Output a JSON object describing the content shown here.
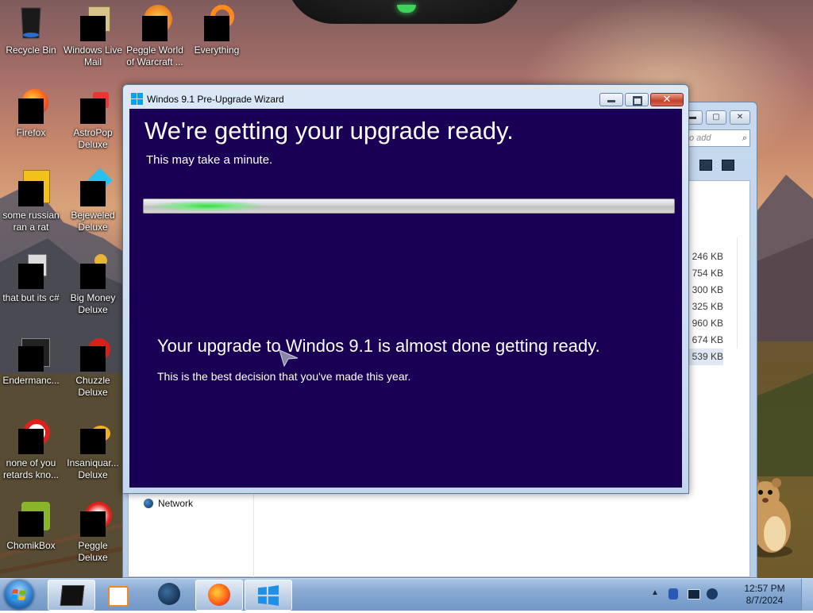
{
  "desktop": {
    "icons": [
      {
        "label": "Recycle Bin",
        "icon": "recycle-bin-icon"
      },
      {
        "label": "Windows Live Mail",
        "icon": "mail-icon"
      },
      {
        "label": "Peggle World of Warcraft ...",
        "icon": "peggle-wow-icon"
      },
      {
        "label": "Everything",
        "icon": "everything-search-icon"
      },
      {
        "label": "Firefox",
        "icon": "firefox-icon"
      },
      {
        "label": "AstroPop Deluxe",
        "icon": "astropop-icon"
      },
      {
        "label": "some russian ran a rat",
        "icon": "file-icon"
      },
      {
        "label": "Bejeweled Deluxe",
        "icon": "bejeweled-icon"
      },
      {
        "label": "that but its c#",
        "icon": "shortcut-icon"
      },
      {
        "label": "Big Money Deluxe",
        "icon": "big-money-icon"
      },
      {
        "label": "Endermanc...",
        "icon": "terminal-icon"
      },
      {
        "label": "Chuzzle Deluxe",
        "icon": "chuzzle-icon"
      },
      {
        "label": "none of you retards kno...",
        "icon": "opera-icon"
      },
      {
        "label": "Insaniquar... Deluxe",
        "icon": "insaniquarium-icon"
      },
      {
        "label": "ChomikBox",
        "icon": "chomikbox-icon"
      },
      {
        "label": "Peggle Deluxe",
        "icon": "peggle-icon"
      }
    ]
  },
  "explorer": {
    "search_placeholder": "o add",
    "network_label": "Network",
    "file_sizes": [
      "246 KB",
      "754 KB",
      "300 KB",
      "325 KB",
      "960 KB",
      "674 KB",
      "539 KB"
    ]
  },
  "wizard": {
    "title": "Windos 9.1 Pre-Upgrade Wizard",
    "headline": "We're getting your upgrade ready.",
    "subheading": "This may take a minute.",
    "progress_indicator": "indeterminate",
    "message": "Your upgrade to Windos 9.1 is almost done getting ready.",
    "message_detail": "This is the best decision that you've made this year.",
    "close_glyph": "✕"
  },
  "taskbar": {
    "items": [
      {
        "name": "taskbar-item-terminal",
        "icon": "terminal-icon"
      },
      {
        "name": "taskbar-item-media-player",
        "icon": "media-player-icon"
      },
      {
        "name": "taskbar-item-steam",
        "icon": "steam-icon"
      },
      {
        "name": "taskbar-item-firefox",
        "icon": "firefox-icon"
      },
      {
        "name": "taskbar-item-upgrade-wizard",
        "icon": "windows-logo-icon",
        "active": true
      }
    ],
    "clock_time": "12:57 PM",
    "clock_date": "8/7/2024"
  },
  "colors": {
    "wizard_background": "#1a0055",
    "progress_glow": "#30e040",
    "taskbar": "#87a9d2"
  }
}
